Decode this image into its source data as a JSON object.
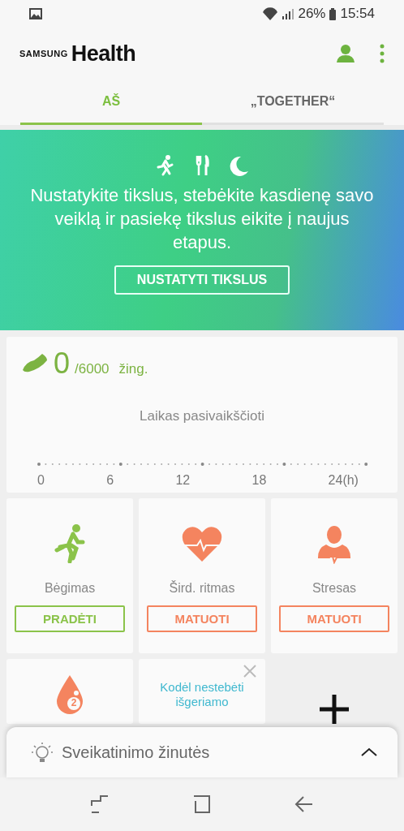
{
  "status_bar": {
    "battery": "26%",
    "time": "15:54"
  },
  "header": {
    "brand": "SAMSUNG",
    "app_name": "Health"
  },
  "tabs": [
    {
      "label": "AŠ",
      "selected": true
    },
    {
      "label": "„TOGETHER“",
      "selected": false
    }
  ],
  "banner": {
    "message": "Nustatykite tikslus, stebėkite kasdienę savo veiklą ir pasiekę tikslus eikite į naujus etapus.",
    "button": "NUSTATYTI TIKSLUS"
  },
  "steps": {
    "count": "0",
    "goal": "/6000",
    "unit": "žing.",
    "message": "Laikas pasivaikščioti",
    "axis_labels": [
      "0",
      "6",
      "12",
      "18",
      "24(h)"
    ]
  },
  "tiles": [
    {
      "kind": "run",
      "label": "Bėgimas",
      "button": "PRADĖTI",
      "color": "#8bc34a"
    },
    {
      "kind": "heart",
      "label": "Šird. ritmas",
      "button": "MATUOTI",
      "color": "#f4845f"
    },
    {
      "kind": "stress",
      "label": "Stresas",
      "button": "MATUOTI",
      "color": "#f4845f"
    },
    {
      "kind": "water",
      "badge": "2",
      "color": "#f4845f"
    },
    {
      "kind": "tip",
      "text": "Kodėl nestebėti išgeriamo"
    },
    {
      "kind": "add"
    }
  ],
  "tips_sheet": {
    "title": "Sveikatinimo žinutės",
    "expanded": false
  }
}
